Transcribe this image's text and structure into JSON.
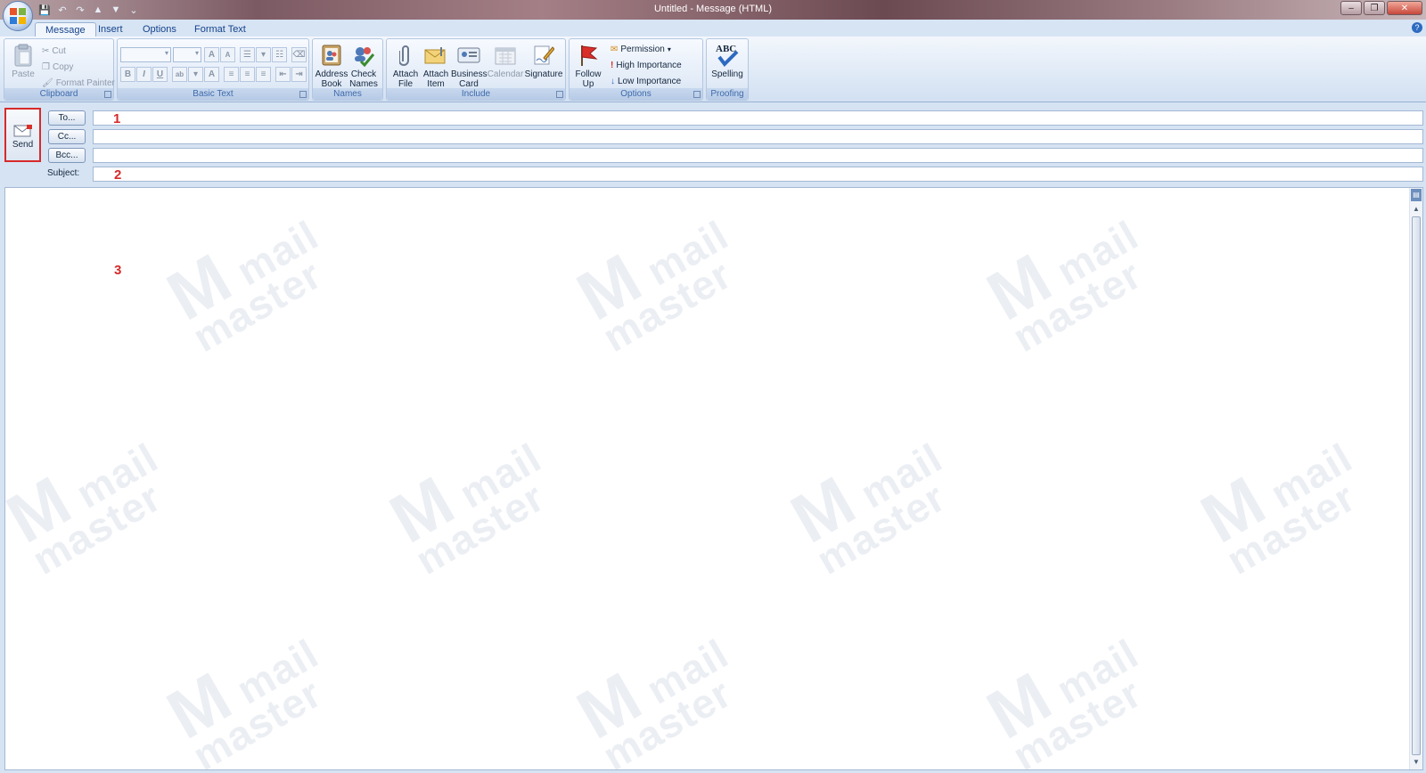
{
  "window": {
    "title": "Untitled - Message (HTML)",
    "minimize_glyph": "–",
    "restore_glyph": "❐",
    "close_glyph": "✕"
  },
  "quick_access": {
    "save_glyph": "💾",
    "undo_glyph": "↶",
    "redo_glyph": "↷",
    "prev_glyph": "▲",
    "next_glyph": "▼",
    "customize_glyph": "⌄"
  },
  "tabs": [
    {
      "label": "Message",
      "active": true
    },
    {
      "label": "Insert",
      "active": false
    },
    {
      "label": "Options",
      "active": false
    },
    {
      "label": "Format Text",
      "active": false
    }
  ],
  "help_glyph": "?",
  "ribbon": {
    "clipboard": {
      "label": "Clipboard",
      "paste": "Paste",
      "cut": "Cut",
      "copy": "Copy",
      "format_painter": "Format Painter"
    },
    "basic_text": {
      "label": "Basic Text",
      "bold": "B",
      "italic": "I",
      "underline": "U",
      "grow": "A",
      "shrink": "A",
      "font_color": "A",
      "highlight": "ab"
    },
    "names": {
      "label": "Names",
      "address_book": "Address Book",
      "check_names": "Check Names"
    },
    "include": {
      "label": "Include",
      "attach_file": "Attach File",
      "attach_item": "Attach Item",
      "business_card": "Business Card",
      "calendar": "Calendar",
      "signature": "Signature"
    },
    "options": {
      "label": "Options",
      "follow_up": "Follow Up",
      "permission": "Permission",
      "high_importance": "High Importance",
      "low_importance": "Low Importance"
    },
    "proofing": {
      "label": "Proofing",
      "spelling": "Spelling",
      "spelling_icon_text": "ABC"
    }
  },
  "compose": {
    "send": "Send",
    "to_button": "To...",
    "cc_button": "Cc...",
    "bcc_button": "Bcc...",
    "subject_label": "Subject:",
    "to_value": "",
    "cc_value": "",
    "bcc_value": "",
    "subject_value": "",
    "body_value": ""
  },
  "callouts": [
    "1",
    "2",
    "3"
  ],
  "watermark": {
    "mark": "M",
    "text_line1": "mail",
    "text_line2": "master"
  },
  "colors": {
    "accent": "#d62a2a",
    "ribbon_text": "#15428b",
    "group_label": "#3e6aaa"
  }
}
